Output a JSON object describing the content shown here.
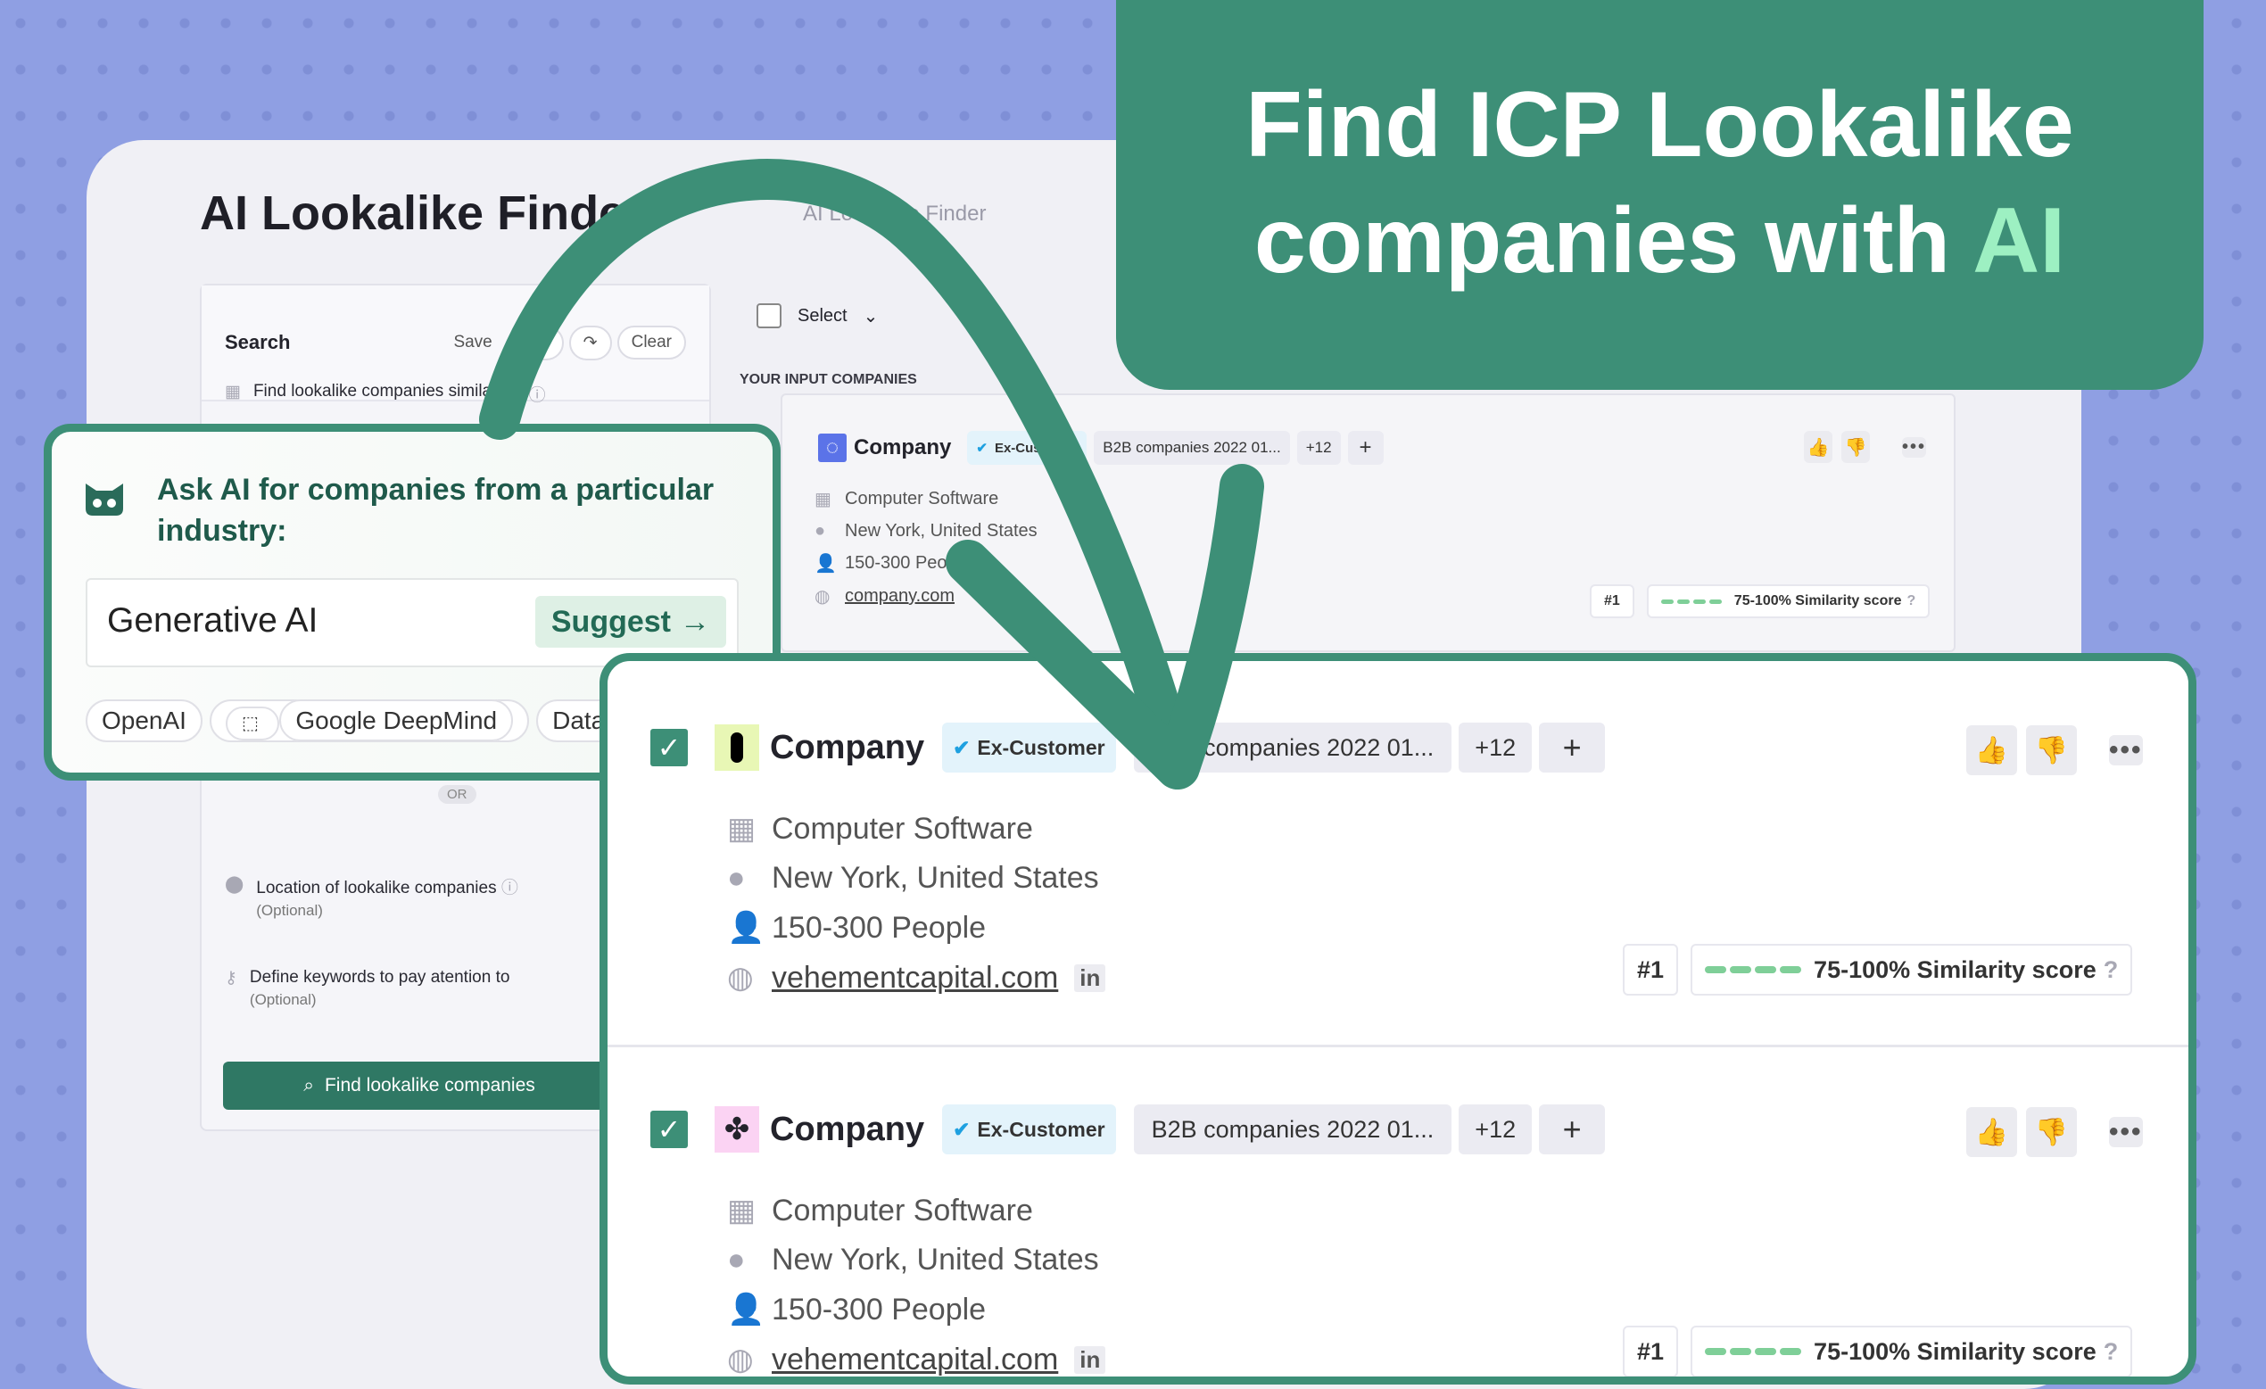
{
  "headline": {
    "line1": "Find ICP Lookalike",
    "line2_prefix": "companies with ",
    "line2_accent": "AI"
  },
  "colors": {
    "brand_green": "#3d8f77",
    "accent": "#9df0c2",
    "background": "#8f9fe3"
  },
  "app": {
    "title": "AI Lookalike Finder",
    "breadcrumb": "AI Lookalike Finder"
  },
  "search": {
    "label": "Search",
    "save": "Save",
    "clear": "Clear",
    "similar_to": "Find lookalike companies similar to",
    "or": "OR",
    "location_label": "Location of lookalike companies",
    "location_optional": "(Optional)",
    "keywords_label": "Define keywords to pay atention to",
    "keywords_optional": "(Optional)",
    "find_button": "Find lookalike companies"
  },
  "list": {
    "select": "Select",
    "section_title": "YOUR INPUT COMPANIES"
  },
  "input_company": {
    "name": "Company",
    "tag_ex": "Ex-Customer",
    "tag_list": "B2B companies 2022 01...",
    "more": "+12",
    "industry": "Computer Software",
    "location": "New York, United States",
    "size": "150-300 People",
    "website": "company.com",
    "rank": "#1",
    "similarity": "75-100% Similarity score",
    "similarity_level": 4
  },
  "ai_popup": {
    "heading": "Ask AI for companies from a particular industry:",
    "input_value": "Generative AI",
    "suggest": "Suggest",
    "chips": [
      "OpenAI",
      "Google DeepMind",
      "DataBricks"
    ]
  },
  "results": [
    {
      "checked": true,
      "name": "Company",
      "tag_ex": "Ex-Customer",
      "tag_list": "B2B companies 2022 01...",
      "more": "+12",
      "industry": "Computer Software",
      "location": "New York, United States",
      "size": "150-300 People",
      "website": "vehementcapital.com",
      "linkedin": "in",
      "rank": "#1",
      "similarity": "75-100% Similarity score",
      "similarity_level": 4
    },
    {
      "checked": true,
      "name": "Company",
      "tag_ex": "Ex-Customer",
      "tag_list": "B2B companies 2022 01...",
      "more": "+12",
      "industry": "Computer Software",
      "location": "New York, United States",
      "size": "150-300 People",
      "website": "vehementcapital.com",
      "linkedin": "in",
      "rank": "#1",
      "similarity": "75-100% Similarity score",
      "similarity_level": 4
    }
  ]
}
